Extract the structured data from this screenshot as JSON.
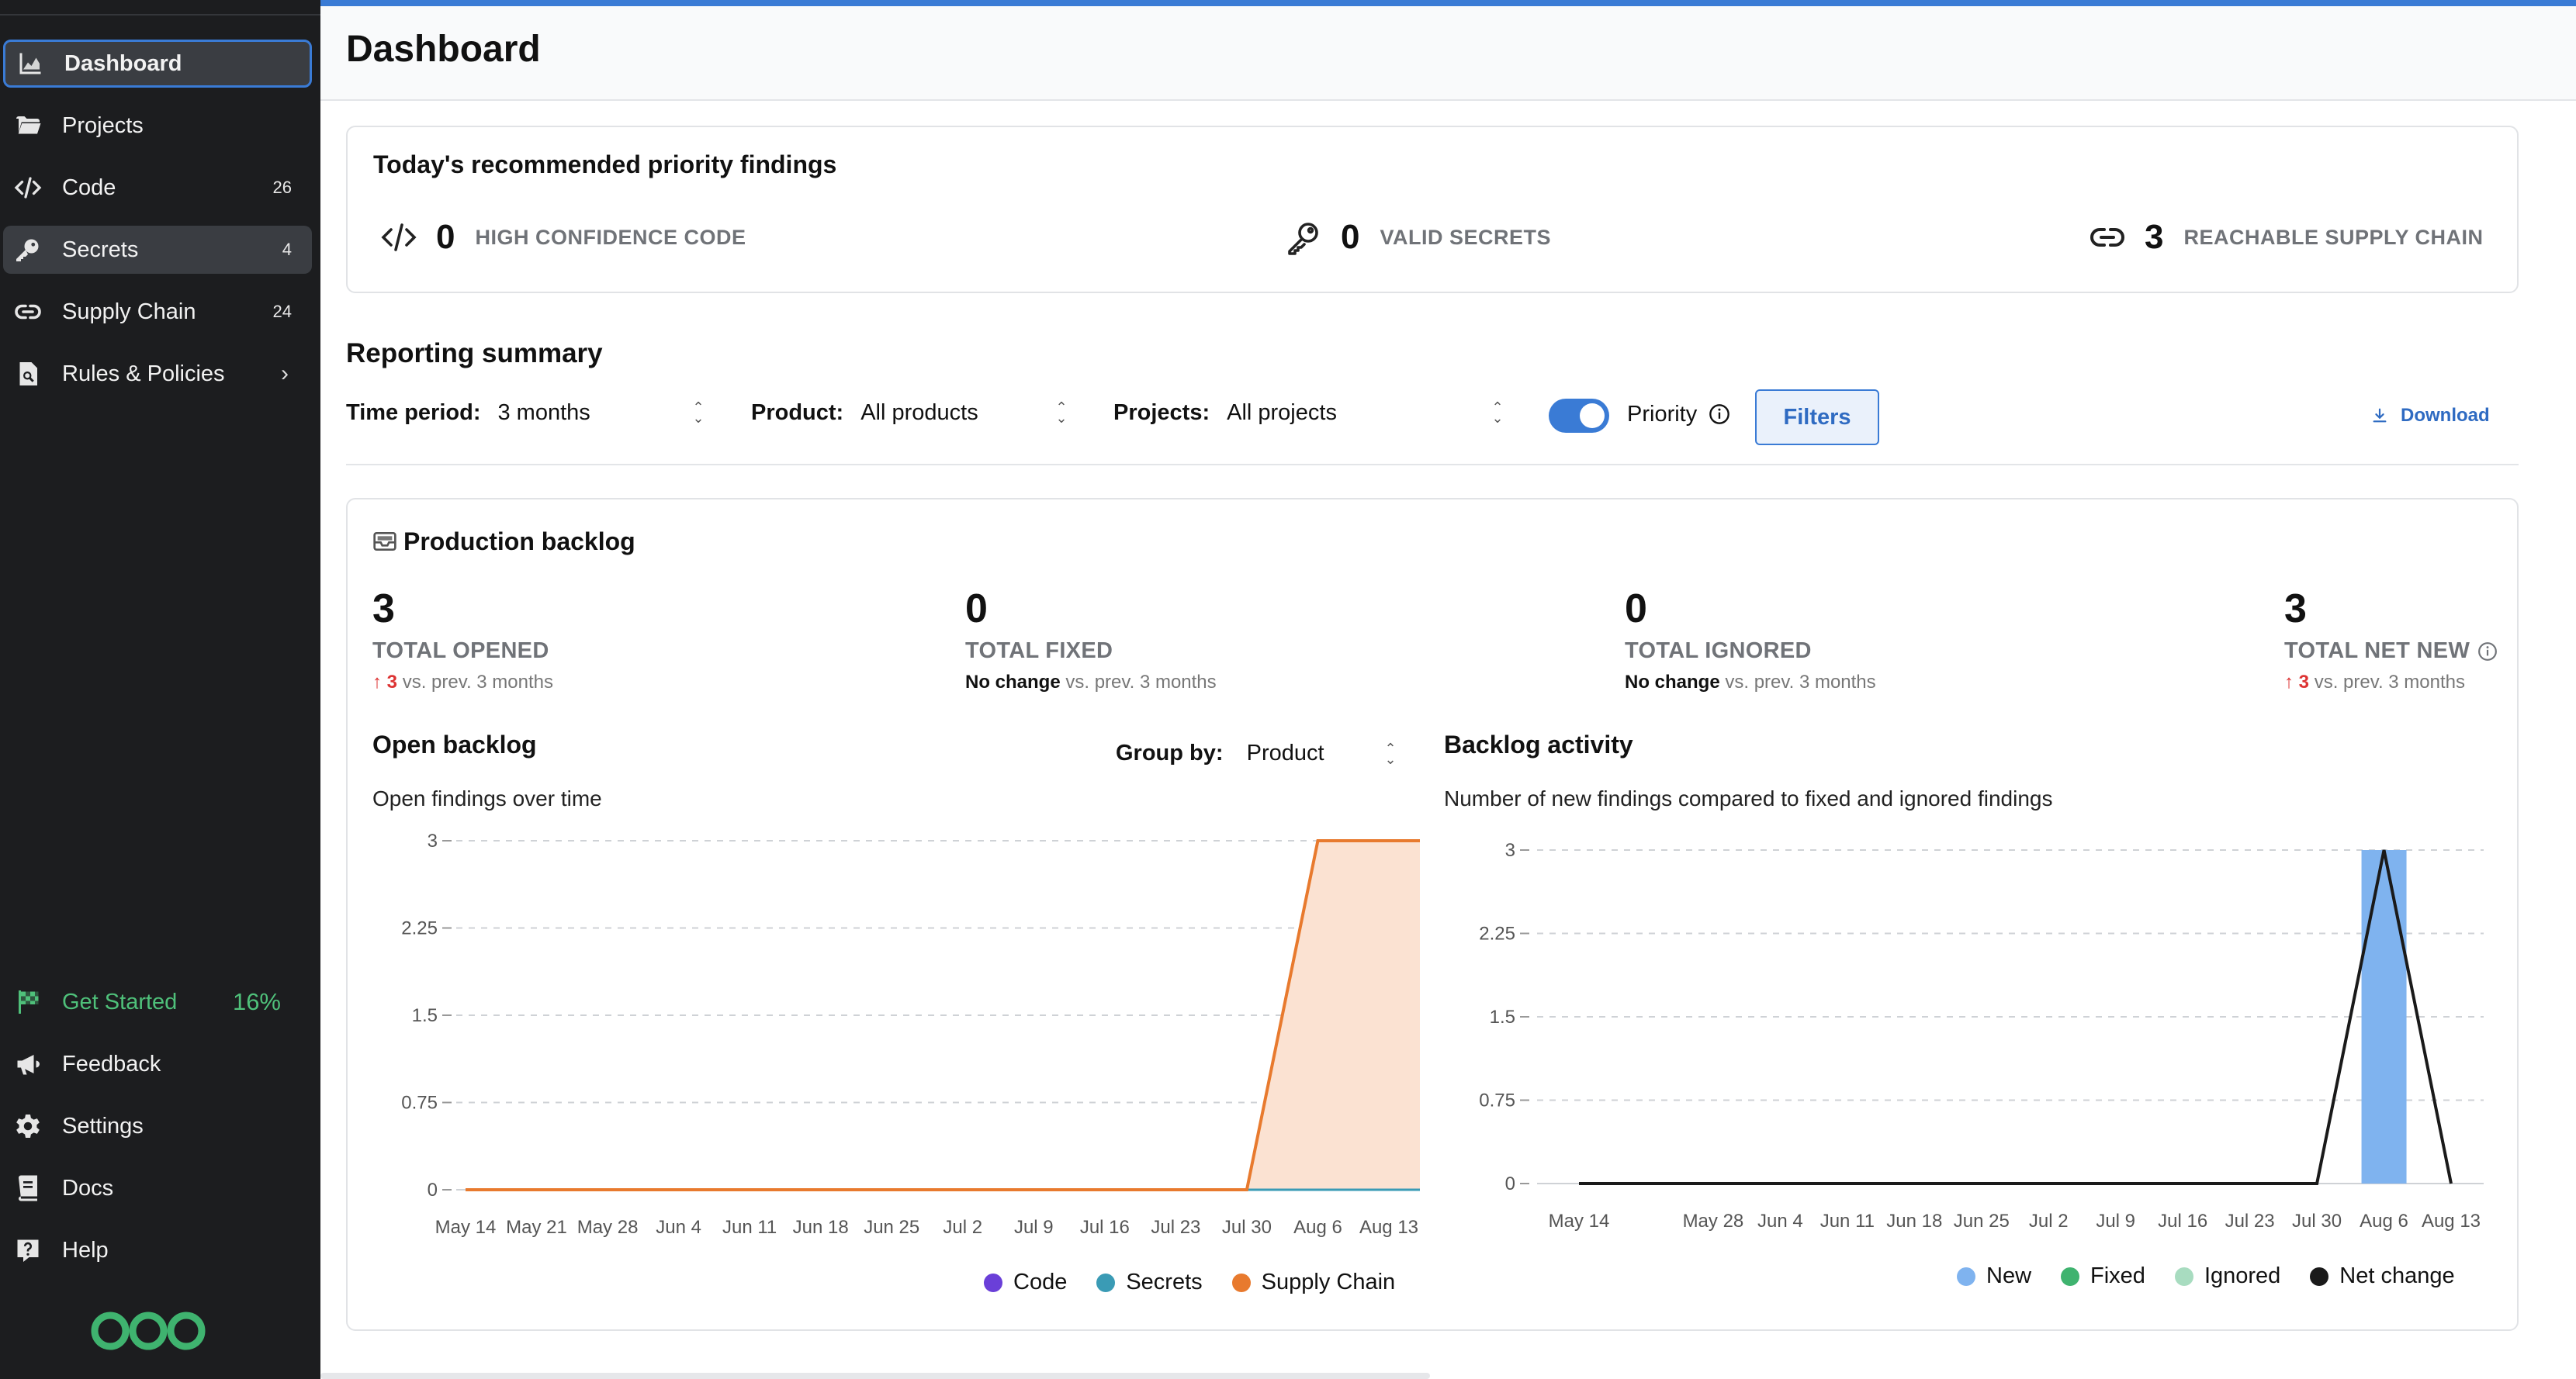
{
  "sidebar": {
    "items": [
      {
        "label": "Dashboard",
        "icon": "chart-icon",
        "count": ""
      },
      {
        "label": "Projects",
        "icon": "folder-icon",
        "count": ""
      },
      {
        "label": "Code",
        "icon": "code-icon",
        "count": "26"
      },
      {
        "label": "Secrets",
        "icon": "key-icon",
        "count": "4"
      },
      {
        "label": "Supply Chain",
        "icon": "link-icon",
        "count": "24"
      },
      {
        "label": "Rules & Policies",
        "icon": "document-search-icon",
        "count": ""
      }
    ],
    "bottom_items": [
      {
        "label": "Get Started",
        "icon": "flag-icon",
        "count": "16%"
      },
      {
        "label": "Feedback",
        "icon": "megaphone-icon"
      },
      {
        "label": "Settings",
        "icon": "gear-icon"
      },
      {
        "label": "Docs",
        "icon": "book-icon"
      },
      {
        "label": "Help",
        "icon": "help-icon"
      }
    ]
  },
  "header": {
    "title": "Dashboard"
  },
  "priority": {
    "title": "Today's recommended priority findings",
    "items": [
      {
        "icon": "code-icon",
        "count": "0",
        "label": "HIGH CONFIDENCE CODE"
      },
      {
        "icon": "key-icon",
        "count": "0",
        "label": "VALID SECRETS"
      },
      {
        "icon": "link-icon",
        "count": "3",
        "label": "REACHABLE SUPPLY CHAIN"
      }
    ]
  },
  "reporting": {
    "title": "Reporting summary",
    "time_period_label": "Time period:",
    "time_period_value": "3 months",
    "product_label": "Product:",
    "product_value": "All products",
    "projects_label": "Projects:",
    "projects_value": "All projects",
    "priority_label": "Priority",
    "filters_label": "Filters",
    "download_label": "Download"
  },
  "backlog": {
    "title": "Production backlog",
    "stats": [
      {
        "value": "3",
        "label": "TOTAL OPENED",
        "change": "3",
        "suffix": "vs. prev. 3 months"
      },
      {
        "value": "0",
        "label": "TOTAL FIXED",
        "change": "No change",
        "suffix": "vs. prev. 3 months"
      },
      {
        "value": "0",
        "label": "TOTAL IGNORED",
        "change": "No change",
        "suffix": "vs. prev. 3 months"
      },
      {
        "value": "3",
        "label": "TOTAL NET NEW",
        "change": "3",
        "suffix": "vs. prev. 3 months"
      }
    ]
  },
  "open_backlog": {
    "title": "Open backlog",
    "subtitle": "Open findings over time",
    "group_by_label": "Group by:",
    "group_by_value": "Product"
  },
  "backlog_activity": {
    "title": "Backlog activity",
    "subtitle": "Number of new findings compared to fixed and ignored findings"
  },
  "colors": {
    "accent": "#3a7bd5",
    "code": "#6a3fd8",
    "secrets": "#3a9bb5",
    "supply_chain": "#e87a2e",
    "new": "#7fb3ef",
    "fixed": "#3fb36f",
    "ignored": "#a8dcc0",
    "net_change": "#1a1a1a"
  },
  "chart_data": [
    {
      "type": "area",
      "title": "Open backlog",
      "categories": [
        "May 14",
        "May 21",
        "May 28",
        "Jun 4",
        "Jun 11",
        "Jun 18",
        "Jun 25",
        "Jul 2",
        "Jul 9",
        "Jul 16",
        "Jul 23",
        "Jul 30",
        "Aug 6",
        "Aug 13"
      ],
      "y_ticks": [
        "0",
        "0.75",
        "1.5",
        "2.25",
        "3"
      ],
      "ylim": [
        0,
        3
      ],
      "grid": true,
      "legend": "bottom",
      "series": [
        {
          "name": "Code",
          "values": [
            0,
            0,
            0,
            0,
            0,
            0,
            0,
            0,
            0,
            0,
            0,
            0,
            0,
            0
          ]
        },
        {
          "name": "Secrets",
          "values": [
            0,
            0,
            0,
            0,
            0,
            0,
            0,
            0,
            0,
            0,
            0,
            0,
            0,
            0
          ]
        },
        {
          "name": "Supply Chain",
          "values": [
            0,
            0,
            0,
            0,
            0,
            0,
            0,
            0,
            0,
            0,
            0,
            0,
            3,
            3
          ]
        }
      ]
    },
    {
      "type": "bar",
      "title": "Backlog activity",
      "categories": [
        "May 14",
        "May 21",
        "May 28",
        "Jun 4",
        "Jun 11",
        "Jun 18",
        "Jun 25",
        "Jul 2",
        "Jul 9",
        "Jul 16",
        "Jul 23",
        "Jul 30",
        "Aug 6",
        "Aug 13"
      ],
      "x_tick_labels": [
        "May 14",
        "",
        "May 28",
        "Jun 4",
        "Jun 11",
        "Jun 18",
        "Jun 25",
        "Jul 2",
        "Jul 9",
        "Jul 16",
        "Jul 23",
        "Jul 30",
        "Aug 6",
        "Aug 13"
      ],
      "y_ticks": [
        "0",
        "0.75",
        "1.5",
        "2.25",
        "3"
      ],
      "ylim": [
        0,
        3
      ],
      "grid": true,
      "legend": "bottom",
      "series": [
        {
          "name": "New",
          "values": [
            0,
            0,
            0,
            0,
            0,
            0,
            0,
            0,
            0,
            0,
            0,
            0,
            3,
            0
          ]
        },
        {
          "name": "Fixed",
          "values": [
            0,
            0,
            0,
            0,
            0,
            0,
            0,
            0,
            0,
            0,
            0,
            0,
            0,
            0
          ]
        },
        {
          "name": "Ignored",
          "values": [
            0,
            0,
            0,
            0,
            0,
            0,
            0,
            0,
            0,
            0,
            0,
            0,
            0,
            0
          ]
        },
        {
          "name": "Net change",
          "values": [
            0,
            0,
            0,
            0,
            0,
            0,
            0,
            0,
            0,
            0,
            0,
            0,
            3,
            0
          ]
        }
      ]
    }
  ]
}
